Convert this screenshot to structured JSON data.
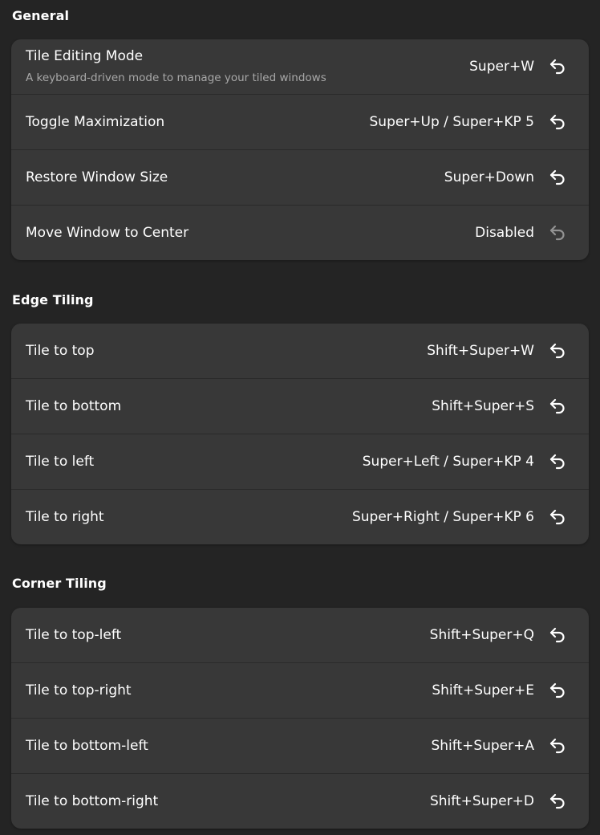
{
  "sections": [
    {
      "title": "General",
      "rows": [
        {
          "title": "Tile Editing Mode",
          "subtitle": "A keyboard-driven mode to manage your tiled windows",
          "accel": "Super+W",
          "reset_enabled": true
        },
        {
          "title": "Toggle Maximization",
          "accel": "Super+Up / Super+KP 5",
          "reset_enabled": true
        },
        {
          "title": "Restore Window Size",
          "accel": "Super+Down",
          "reset_enabled": true
        },
        {
          "title": "Move Window to Center",
          "accel": "Disabled",
          "reset_enabled": false
        }
      ]
    },
    {
      "title": "Edge Tiling",
      "rows": [
        {
          "title": "Tile to top",
          "accel": "Shift+Super+W",
          "reset_enabled": true
        },
        {
          "title": "Tile to bottom",
          "accel": "Shift+Super+S",
          "reset_enabled": true
        },
        {
          "title": "Tile to left",
          "accel": "Super+Left / Super+KP 4",
          "reset_enabled": true
        },
        {
          "title": "Tile to right",
          "accel": "Super+Right / Super+KP 6",
          "reset_enabled": true
        }
      ]
    },
    {
      "title": "Corner Tiling",
      "rows": [
        {
          "title": "Tile to top-left",
          "accel": "Shift+Super+Q",
          "reset_enabled": true
        },
        {
          "title": "Tile to top-right",
          "accel": "Shift+Super+E",
          "reset_enabled": true
        },
        {
          "title": "Tile to bottom-left",
          "accel": "Shift+Super+A",
          "reset_enabled": true
        },
        {
          "title": "Tile to bottom-right",
          "accel": "Shift+Super+D",
          "reset_enabled": true
        }
      ]
    }
  ],
  "icons": {
    "reset": "undo-arrow-icon"
  },
  "colors": {
    "background": "#242424",
    "card": "#383838",
    "text": "#ffffff",
    "subtitle": "#a8a8a8"
  }
}
